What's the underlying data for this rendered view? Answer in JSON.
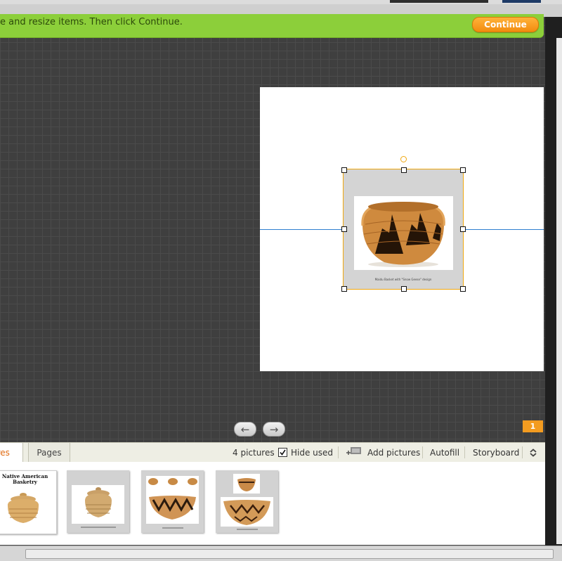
{
  "banner": {
    "instruction": "e and resize items. Then click Continue.",
    "continue_label": "Continue"
  },
  "canvas": {
    "photo_caption": "Maidu Basket with \"Snow Geese\" design"
  },
  "navigation": {
    "prev_icon": "←",
    "next_icon": "→",
    "page_number": "1"
  },
  "tray": {
    "tabs": [
      {
        "label": "ures"
      },
      {
        "label": "Pages"
      }
    ],
    "picture_count": "4 pictures",
    "hide_used_label": "Hide used",
    "hide_used_checked": true,
    "add_pictures_label": "Add pictures",
    "autofill_label": "Autofill",
    "storyboard_label": "Storyboard"
  },
  "thumbnails": [
    {
      "title": "Native American",
      "subtitle": "Basketry"
    },
    {
      "title": ""
    },
    {
      "title": ""
    },
    {
      "title": ""
    }
  ],
  "colors": {
    "banner_green": "#8ccf3a",
    "continue_orange": "#f28c0f",
    "selection_orange": "#f0a810",
    "guide_blue": "#2f7fd0",
    "active_tab_text": "#e06a10"
  }
}
